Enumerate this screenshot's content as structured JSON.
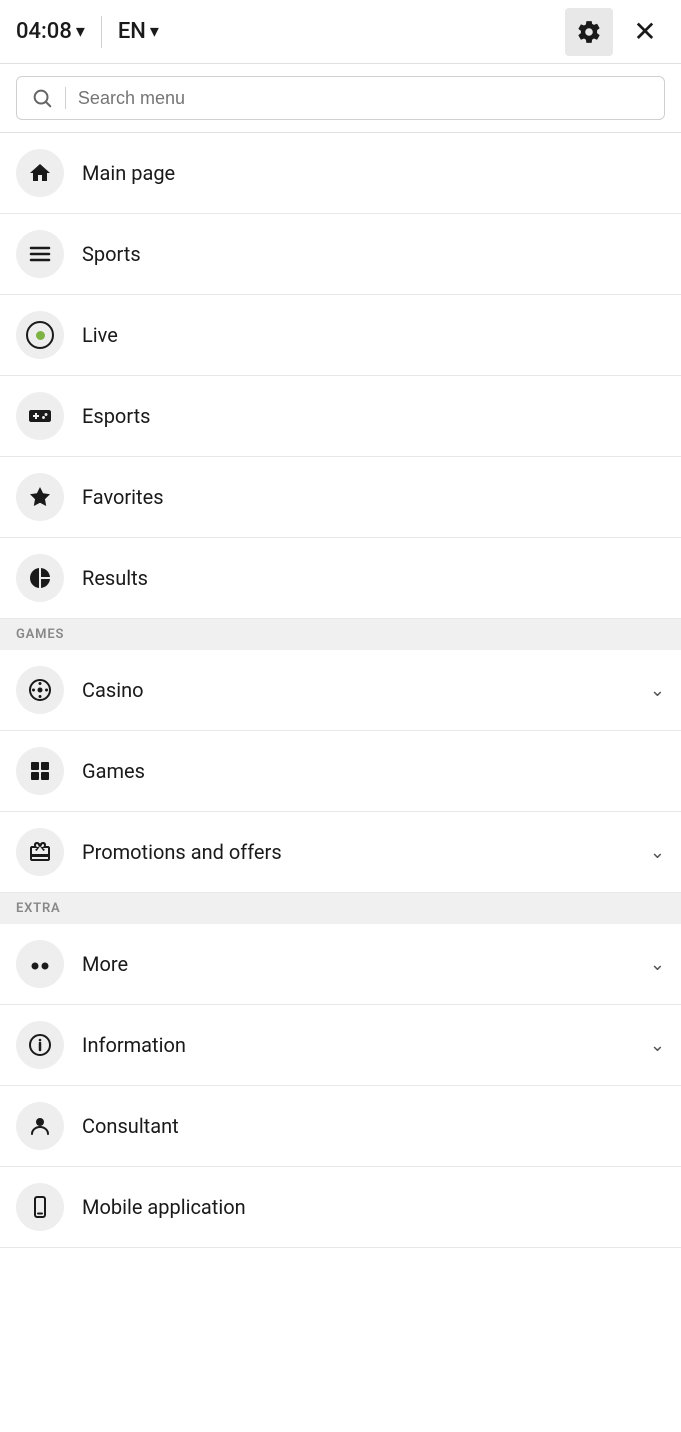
{
  "header": {
    "time": "04:08",
    "time_chevron": "▾",
    "lang": "EN",
    "lang_chevron": "▾",
    "gear_label": "Settings",
    "close_label": "✕"
  },
  "search": {
    "placeholder": "Search menu"
  },
  "menu": {
    "items": [
      {
        "id": "main-page",
        "label": "Main page",
        "icon": "home",
        "has_chevron": false
      },
      {
        "id": "sports",
        "label": "Sports",
        "icon": "sports",
        "has_chevron": false
      },
      {
        "id": "live",
        "label": "Live",
        "icon": "live",
        "has_chevron": false
      },
      {
        "id": "esports",
        "label": "Esports",
        "icon": "esports",
        "has_chevron": false
      },
      {
        "id": "favorites",
        "label": "Favorites",
        "icon": "star",
        "has_chevron": false
      },
      {
        "id": "results",
        "label": "Results",
        "icon": "results",
        "has_chevron": false
      }
    ],
    "sections": [
      {
        "id": "games",
        "label": "GAMES",
        "items": [
          {
            "id": "casino",
            "label": "Casino",
            "icon": "casino",
            "has_chevron": true
          },
          {
            "id": "games",
            "label": "Games",
            "icon": "games",
            "has_chevron": false
          },
          {
            "id": "promotions",
            "label": "Promotions and offers",
            "icon": "promotions",
            "has_chevron": true
          }
        ]
      },
      {
        "id": "extra",
        "label": "EXTRA",
        "items": [
          {
            "id": "more",
            "label": "More",
            "icon": "more",
            "has_chevron": true
          },
          {
            "id": "information",
            "label": "Information",
            "icon": "info",
            "has_chevron": true
          },
          {
            "id": "consultant",
            "label": "Consultant",
            "icon": "consultant",
            "has_chevron": false
          },
          {
            "id": "mobile-app",
            "label": "Mobile application",
            "icon": "mobile",
            "has_chevron": false
          }
        ]
      }
    ]
  }
}
